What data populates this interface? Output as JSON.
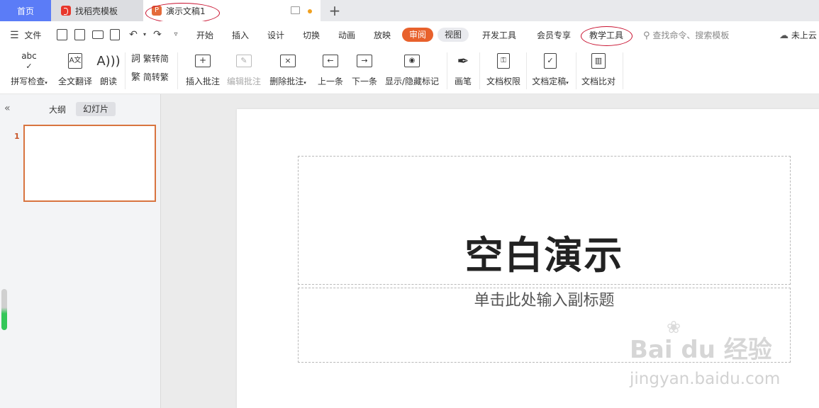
{
  "tabs": {
    "home": "首页",
    "docer": "找稻壳模板",
    "document": "演示文稿1"
  },
  "menu": {
    "file": "文件",
    "items": [
      "开始",
      "插入",
      "设计",
      "切换",
      "动画",
      "放映"
    ],
    "active": "审阅",
    "view": "视图",
    "items2": [
      "开发工具",
      "会员专享"
    ],
    "teaching": "教学工具",
    "search_placeholder": "查找命令、搜索模板",
    "cloud": "未上云"
  },
  "ribbon": {
    "spell": "拼写检查",
    "translate": "全文翻译",
    "read": "朗读",
    "trad_to_simp": "繁转简",
    "simp_to_trad": "简转繁",
    "insert_comment": "插入批注",
    "edit_comment": "编辑批注",
    "delete_comment": "删除批注",
    "prev": "上一条",
    "next": "下一条",
    "show_hide": "显示/隐藏标记",
    "pen": "画笔",
    "permission": "文档权限",
    "finalize": "文档定稿",
    "compare": "文档比对"
  },
  "panel": {
    "outline": "大纲",
    "slides": "幻灯片",
    "slide_number": "1"
  },
  "slide": {
    "title": "空白演示",
    "subtitle": "单击此处输入副标题"
  },
  "watermark": {
    "brand": "Bai du 经验",
    "url": "jingyan.baidu.com"
  },
  "colors": {
    "accent": "#e8612c",
    "home_tab": "#5b7cf7",
    "annotation": "#c8102e"
  }
}
